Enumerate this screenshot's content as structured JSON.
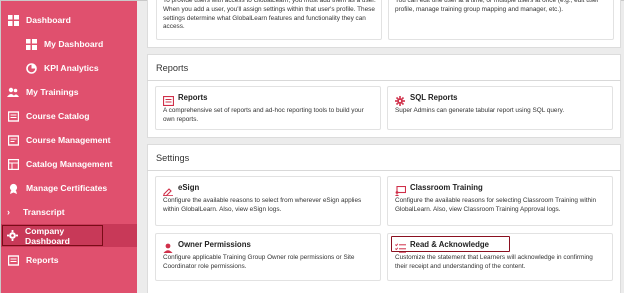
{
  "sidebar": {
    "items": [
      {
        "label": "Dashboard",
        "icon": "dashboard-icon"
      },
      {
        "label": "My Dashboard",
        "icon": "my-dashboard-icon"
      },
      {
        "label": "KPI Analytics",
        "icon": "kpi-analytics-icon"
      },
      {
        "label": "My Trainings",
        "icon": "trainings-icon"
      },
      {
        "label": "Course Catalog",
        "icon": "course-catalog-icon"
      },
      {
        "label": "Course Management",
        "icon": "course-management-icon"
      },
      {
        "label": "Catalog Management",
        "icon": "catalog-management-icon"
      },
      {
        "label": "Manage Certificates",
        "icon": "certificate-icon"
      },
      {
        "label": "Transcript",
        "icon": "chevron-right-icon"
      },
      {
        "label": "Company Dashboard",
        "icon": "gear-icon"
      },
      {
        "label": "Reports",
        "icon": "reports-icon"
      }
    ]
  },
  "top_section": {
    "left_desc": "To provide users with access to GlobalLearn, you must add them as a user. When you add a user, you'll assign settings within that user's profile. These settings determine what GlobalLearn features and functionality they can access.",
    "right_desc": "You can edit one user at a time, or multiple users at once (e.g., edit user profile, manage training group mapping and manager, etc.)."
  },
  "reports_section": {
    "title": "Reports",
    "cards": [
      {
        "title": "Reports",
        "icon": "reports-list-icon",
        "desc": "A comprehensive set of reports and ad-hoc reporting tools to build your own reports."
      },
      {
        "title": "SQL Reports",
        "icon": "sql-gear-icon",
        "desc": "Super Admins can generate tabular report using SQL query."
      }
    ]
  },
  "settings_section": {
    "title": "Settings",
    "cards": [
      {
        "title": "eSign",
        "icon": "esign-icon",
        "desc": "Configure the available reasons to select from wherever eSign applies within GlobalLearn. Also, view eSign logs."
      },
      {
        "title": "Classroom Training",
        "icon": "classroom-icon",
        "desc": "Configure the available reasons for selecting Classroom Training within GlobalLearn. Also, view Classroom Training Approval logs."
      },
      {
        "title": "Owner Permissions",
        "icon": "owner-icon",
        "desc": "Configure applicable Training Group Owner role permissions or Site Coordinator role permissions."
      },
      {
        "title": "Read & Acknowledge",
        "icon": "read-acknowledge-icon",
        "desc": "Customize the statement that Learners will acknowledge in confirming their receipt and understanding of the content."
      }
    ]
  },
  "colors": {
    "sidebar_bg": "#e0506e",
    "sidebar_active": "#c83958",
    "highlight_border": "#8a1020",
    "icon_red": "#d0304a"
  }
}
